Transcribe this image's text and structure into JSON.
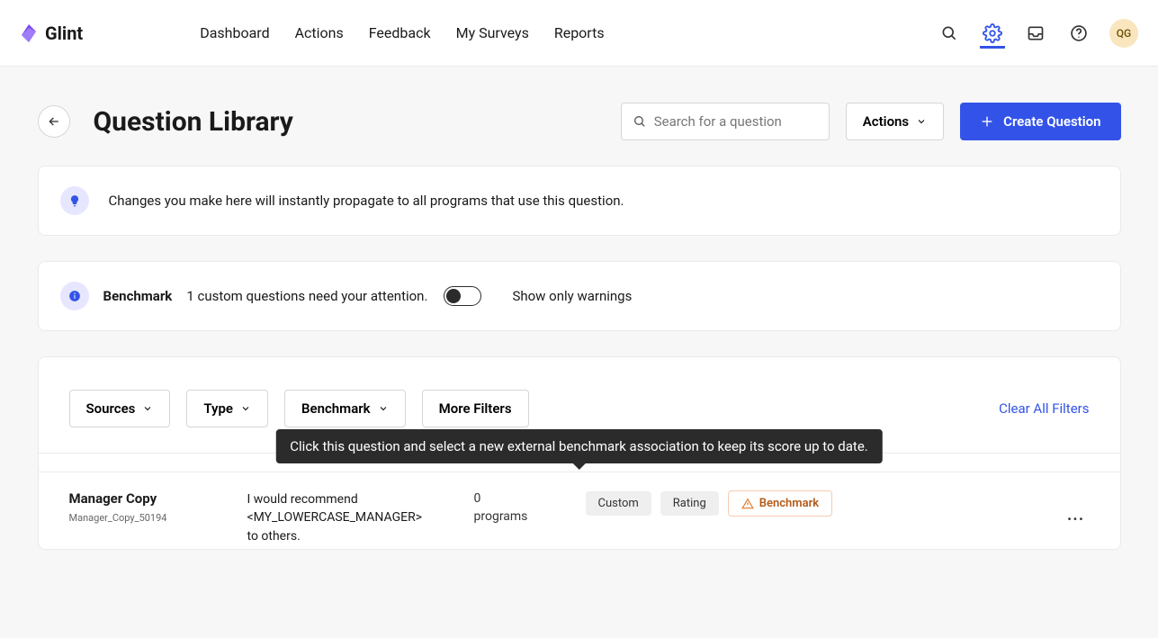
{
  "app_name": "Glint",
  "nav": {
    "dashboard": "Dashboard",
    "actions": "Actions",
    "feedback": "Feedback",
    "my_surveys": "My Surveys",
    "reports": "Reports"
  },
  "avatar_initials": "QG",
  "page_title": "Question Library",
  "search_placeholder": "Search for a question",
  "actions_button": "Actions",
  "create_button": "Create Question",
  "info_notice": "Changes you make here will instantly propagate to all programs that use this question.",
  "benchmark": {
    "label": "Benchmark",
    "message": "1 custom questions need your attention.",
    "show_only": "Show only warnings"
  },
  "filters": {
    "sources": "Sources",
    "type": "Type",
    "benchmark": "Benchmark",
    "more": "More Filters",
    "clear": "Clear All Filters"
  },
  "tooltip": "Click this question and select a new external benchmark association to keep its score up to date.",
  "row": {
    "name": "Manager Copy",
    "id": "Manager_Copy_50194",
    "text": "I would recommend <MY_LOWERCASE_MANAGER> to others.",
    "programs_count": "0",
    "programs_label": "programs",
    "tag_custom": "Custom",
    "tag_rating": "Rating",
    "tag_benchmark": "Benchmark"
  }
}
